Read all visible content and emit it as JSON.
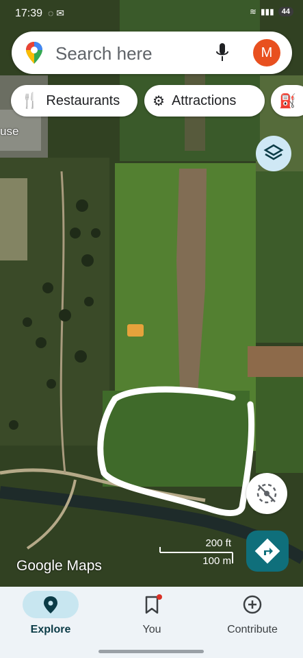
{
  "status_bar": {
    "time": "17:39",
    "battery": "44"
  },
  "search": {
    "placeholder": "Search here",
    "avatar_initial": "M"
  },
  "chips": [
    {
      "label": "Restaurants",
      "icon": "fork-knife-icon"
    },
    {
      "label": "Attractions",
      "icon": "ferris-wheel-icon"
    },
    {
      "label": "",
      "icon": "gas-station-icon"
    }
  ],
  "map": {
    "partial_label": "use",
    "scale_imperial": "200 ft",
    "scale_metric": "100 m",
    "brand": "Google Maps",
    "colors": {
      "field_green": "#4f7a2e",
      "dirt_track": "#8a6a5a",
      "boundary_marker": "#ffffff"
    }
  },
  "bottom_nav": {
    "tabs": [
      {
        "label": "Explore",
        "icon": "location-pin-icon",
        "active": true
      },
      {
        "label": "You",
        "icon": "bookmark-icon",
        "active": false
      },
      {
        "label": "Contribute",
        "icon": "add-circle-icon",
        "active": false
      }
    ]
  }
}
